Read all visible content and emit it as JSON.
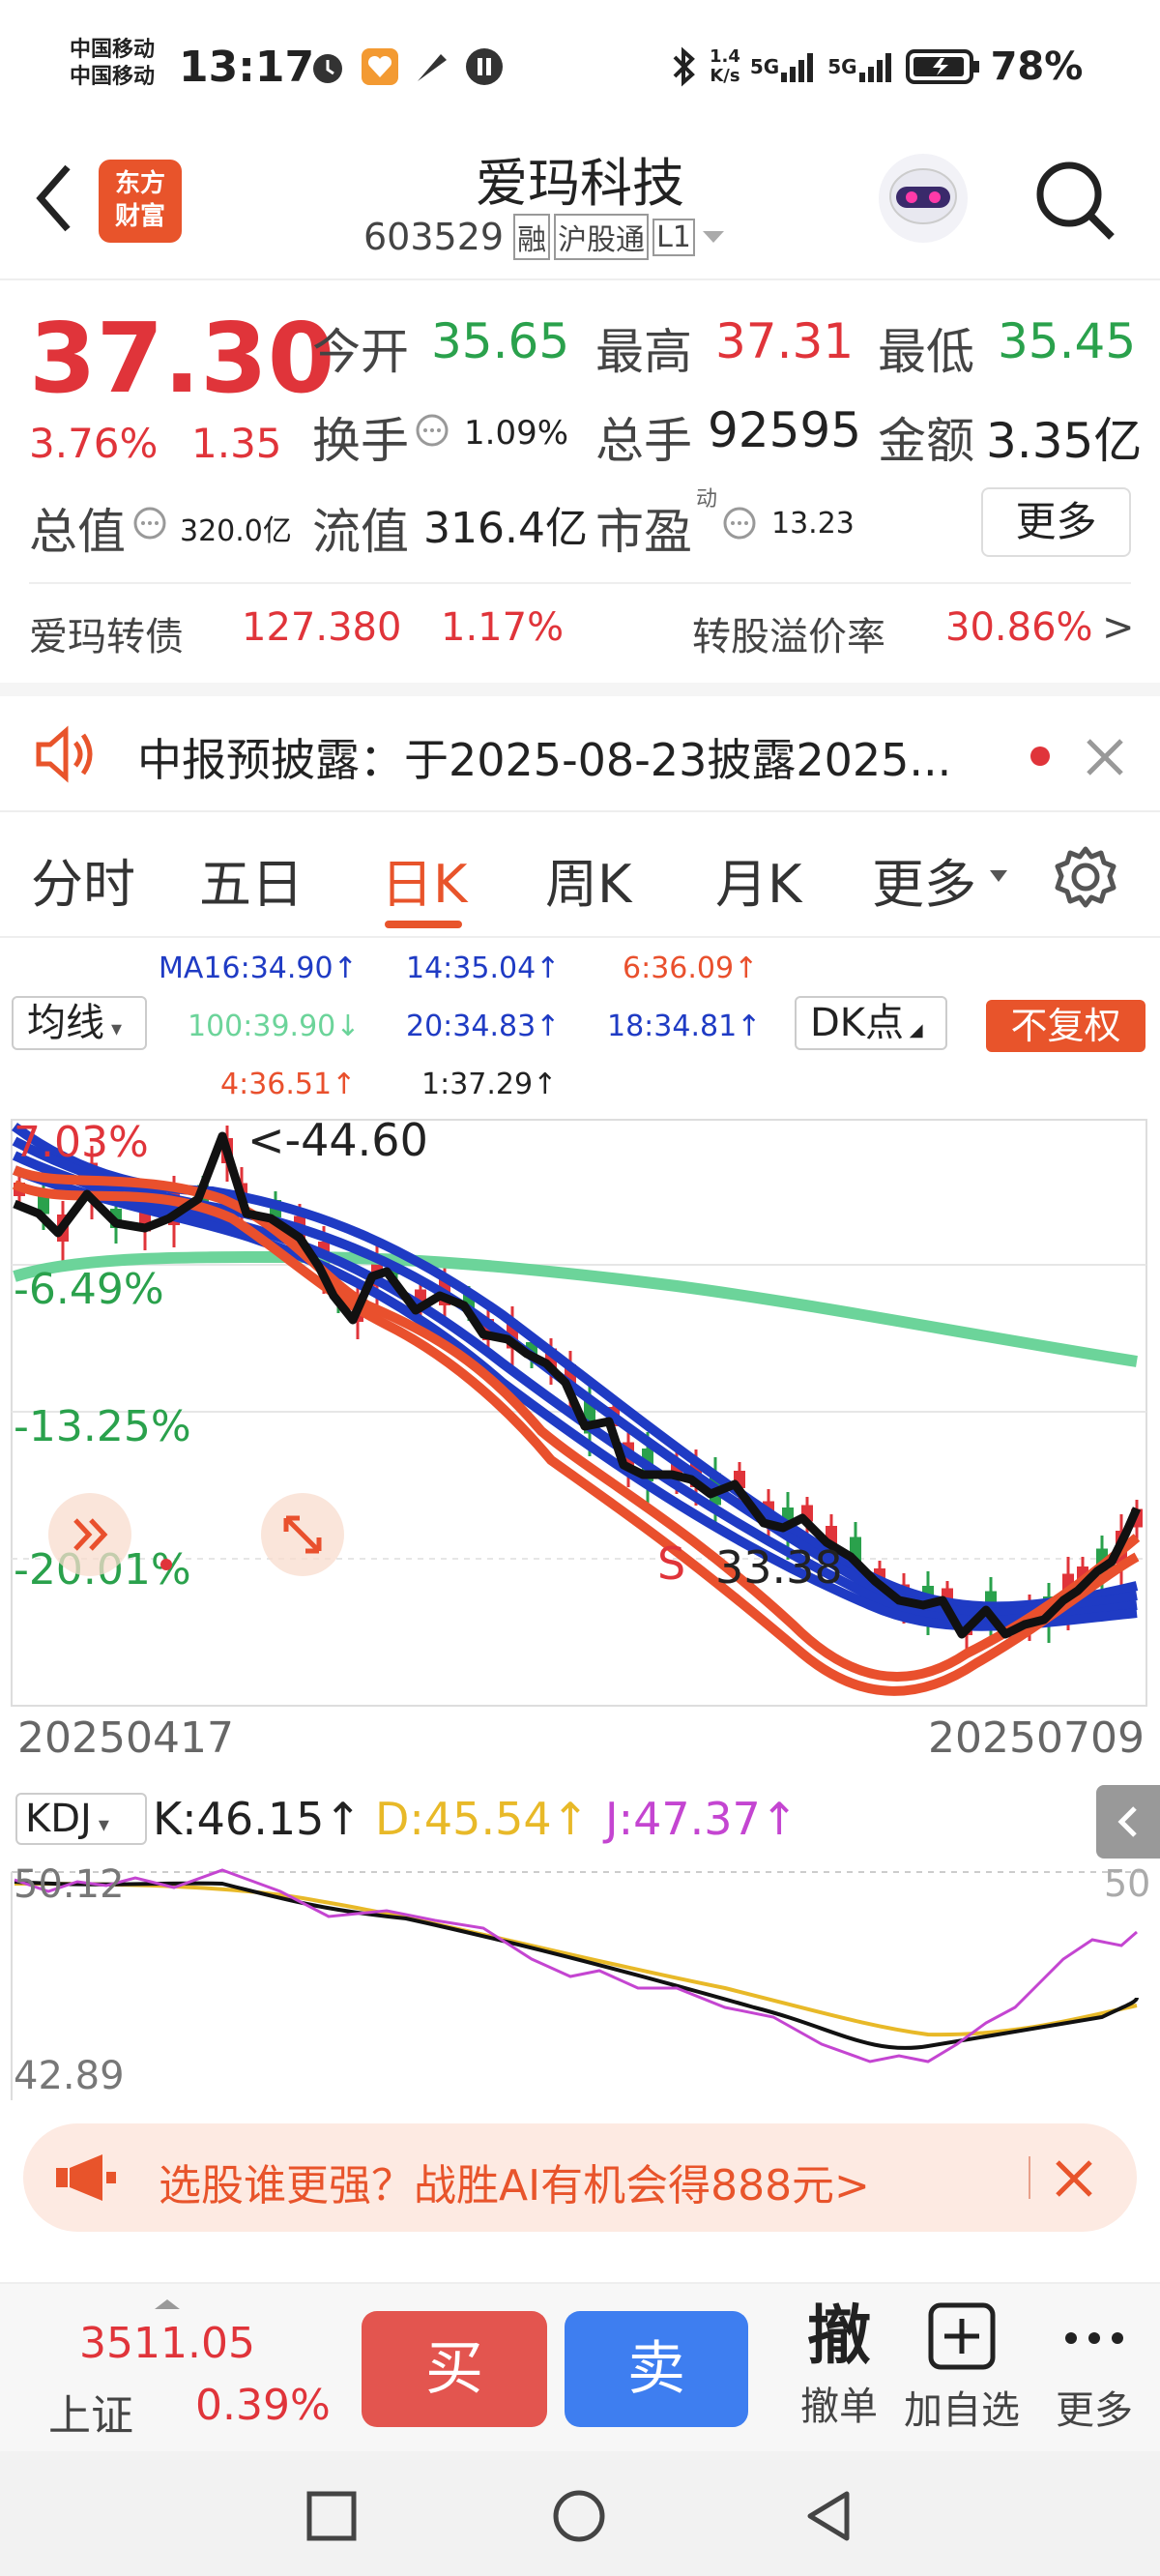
{
  "status": {
    "carrier1": "中国移动",
    "carrier2": "中国移动",
    "time": "13:17",
    "net_speed_top": "1.4",
    "net_speed_bottom": "K/s",
    "sig1": "5G",
    "sig2": "5G",
    "battery": "78%"
  },
  "nav": {
    "title": "爱玛科技",
    "code": "603529",
    "tag1": "融",
    "tag2": "沪股通",
    "tag3": "L1",
    "logo_line1": "东方",
    "logo_line2": "财富"
  },
  "quote": {
    "price": "37.30",
    "change_pct": "3.76%",
    "change": "1.35",
    "open_label": "今开",
    "open": "35.65",
    "high_label": "最高",
    "high": "37.31",
    "low_label": "最低",
    "low": "35.45",
    "turnover_label": "换手",
    "turnover": "1.09%",
    "volume_label": "总手",
    "volume": "92595",
    "amount_label": "金额",
    "amount": "3.35亿",
    "mcap_label": "总值",
    "mcap": "320.0亿",
    "float_label": "流值",
    "float": "316.4亿",
    "pe_label": "市盈",
    "pe_sup": "动",
    "pe": "13.23",
    "more": "更多"
  },
  "bond": {
    "name": "爱玛转债",
    "price": "127.380",
    "pct": "1.17%",
    "premium_label": "转股溢价率",
    "premium": "30.86%",
    "arrow": ">"
  },
  "notice": {
    "text": "中报预披露：于2025-08-23披露2025..."
  },
  "tabs": [
    "分时",
    "五日",
    "日K",
    "周K",
    "月K",
    "更多"
  ],
  "ma": {
    "selector": "均线",
    "dk": "DK点",
    "fq": "不复权",
    "l1": "MA16:34.90↑",
    "l2": "14:35.04↑",
    "l3": "6:36.09↑",
    "l4": "100:39.90↓",
    "l5": "20:34.83↑",
    "l6": "18:34.81↑",
    "l7": "4:36.51↑",
    "l8": "1:37.29↑"
  },
  "chart": {
    "pct_top": "7.03%",
    "pct_2": "-6.49%",
    "pct_3": "-13.25%",
    "pct_4": "-20.01%",
    "high_marker": "<-44.60",
    "s_marker": "S",
    "low_marker": "33.38",
    "date_start": "20250417",
    "date_end": "20250709",
    "colors": {
      "up": "#e0343a",
      "down": "#2aa14c",
      "ma_blue": "#1f3bc4",
      "ma_green": "#6cd49a",
      "ma_red": "#e9502d"
    }
  },
  "kdj": {
    "label": "KDJ",
    "k": "K:46.15↑",
    "d": "D:45.54↑",
    "j": "J:47.37↑",
    "top_left": "50.12",
    "top_right": "50",
    "bottom_left": "42.89"
  },
  "ad": {
    "text": "选股谁更强？战胜AI有机会得888元>"
  },
  "bottom": {
    "index_value": "3511.05",
    "index_name": "上证",
    "index_pct": "0.39%",
    "buy": "买",
    "sell": "卖",
    "cancel_icon": "撤",
    "cancel": "撤单",
    "add": "加自选",
    "more": "更多"
  }
}
